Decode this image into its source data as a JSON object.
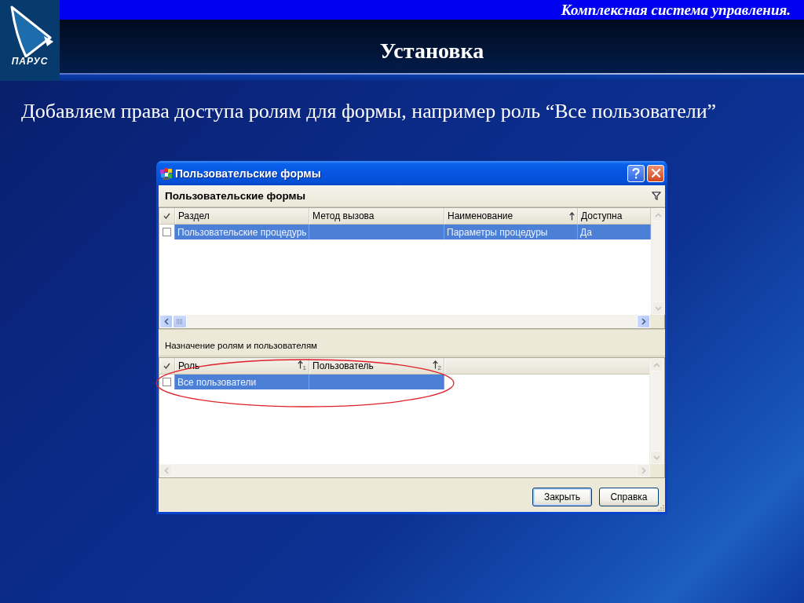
{
  "header": {
    "logo_text": "ПАРУС",
    "tagline": "Комплексная система управления.",
    "title": "Установка"
  },
  "instruction": "Добавляем права доступа ролям для формы, например роль “Все пользователи”",
  "dialog": {
    "title": "Пользовательские формы",
    "forms_panel": {
      "title": "Пользовательские формы",
      "active": true,
      "columns": [
        {
          "label": "Раздел",
          "sorted": false
        },
        {
          "label": "Метод вызова",
          "sorted": false
        },
        {
          "label": "Наименование",
          "sorted": true
        },
        {
          "label": "Доступна",
          "sorted": false
        }
      ],
      "rows": [
        {
          "checked": false,
          "selected": true,
          "cells": [
            "Пользовательские процедурь",
            null,
            "Параметры процедуры",
            "Да"
          ]
        }
      ]
    },
    "roles_panel": {
      "title": "Назначение ролям и пользователям",
      "active": false,
      "columns": [
        {
          "label": "Роль",
          "sorted": true,
          "sort_order": "1"
        },
        {
          "label": "Пользователь",
          "sorted": true,
          "sort_order": "2"
        }
      ],
      "rows": [
        {
          "checked": false,
          "selected": true,
          "cells": [
            "Все пользователи",
            null
          ]
        }
      ]
    },
    "buttons": [
      {
        "label": "Закрыть",
        "default": true
      },
      {
        "label": "Справка",
        "default": false
      }
    ]
  }
}
